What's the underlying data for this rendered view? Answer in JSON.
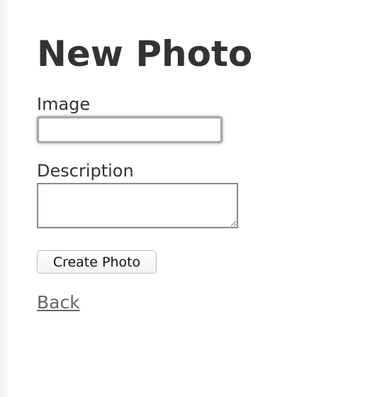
{
  "page": {
    "title": "New Photo"
  },
  "form": {
    "image": {
      "label": "Image",
      "value": ""
    },
    "description": {
      "label": "Description",
      "value": ""
    },
    "submit_label": "Create Photo"
  },
  "nav": {
    "back_label": "Back"
  }
}
